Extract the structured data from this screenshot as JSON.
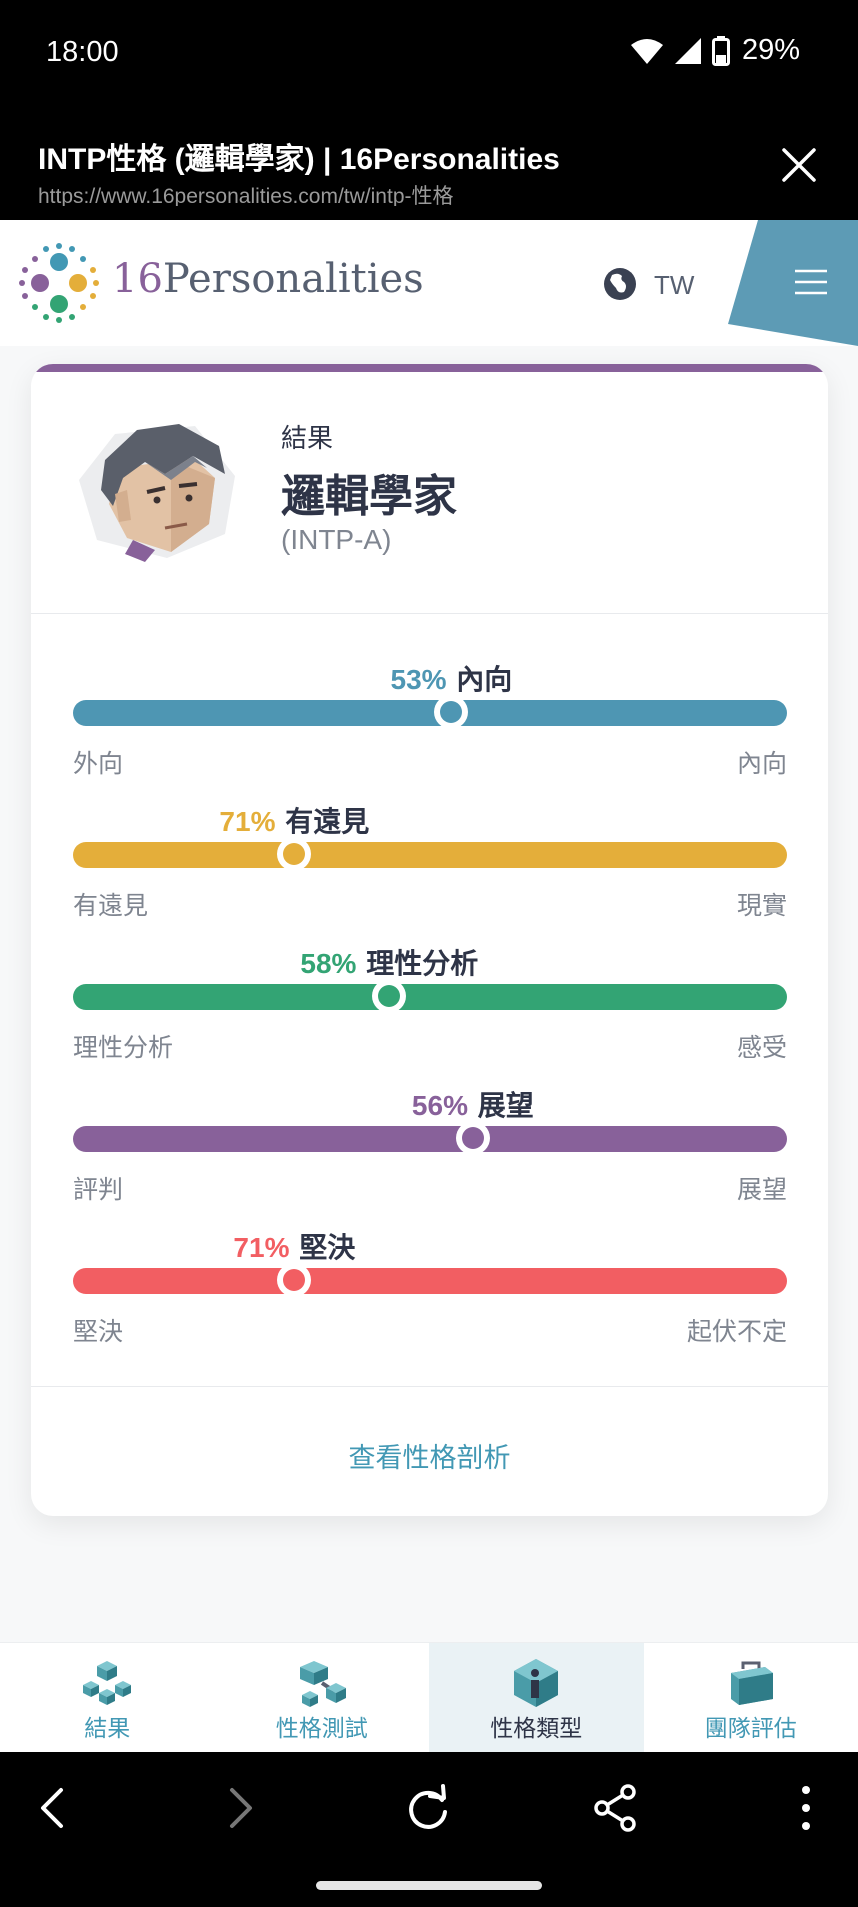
{
  "status": {
    "time": "18:00",
    "battery": "29%"
  },
  "tab": {
    "title": "INTP性格 (邏輯學家) | 16Personalities",
    "url": "https://www.16personalities.com/tw/intp-性格"
  },
  "header": {
    "logo_number": "16",
    "logo_word": "Personalities",
    "language": "TW",
    "wedge_color": "#5d9bb5"
  },
  "result": {
    "label": "結果",
    "type_name": "邏輯學家",
    "type_code": "(INTP-A)",
    "accent_color": "#88619a"
  },
  "traits": [
    {
      "percent": "53%",
      "name": "內向",
      "left_label": "外向",
      "right_label": "內向",
      "position": 0.53,
      "color": "#4e96b3"
    },
    {
      "percent": "71%",
      "name": "有遠見",
      "left_label": "有遠見",
      "right_label": "現實",
      "position": 0.31,
      "color": "#e4ae3a"
    },
    {
      "percent": "58%",
      "name": "理性分析",
      "left_label": "理性分析",
      "right_label": "感受",
      "position": 0.443,
      "color": "#33a474"
    },
    {
      "percent": "56%",
      "name": "展望",
      "left_label": "評判",
      "right_label": "展望",
      "position": 0.56,
      "color": "#88619a"
    },
    {
      "percent": "71%",
      "name": "堅決",
      "left_label": "堅決",
      "right_label": "起伏不定",
      "position": 0.31,
      "color": "#f25e62"
    }
  ],
  "view_profile_link": "查看性格剖析",
  "bottom_nav": [
    {
      "label": "結果",
      "icon": "results-cubes-icon",
      "active": false
    },
    {
      "label": "性格測試",
      "icon": "test-cubes-icon",
      "active": false
    },
    {
      "label": "性格類型",
      "icon": "info-gem-icon",
      "active": true
    },
    {
      "label": "團隊評估",
      "icon": "briefcase-icon",
      "active": false
    }
  ],
  "browser_controls": [
    "back-icon",
    "forward-icon",
    "reload-icon",
    "share-icon",
    "more-icon"
  ]
}
